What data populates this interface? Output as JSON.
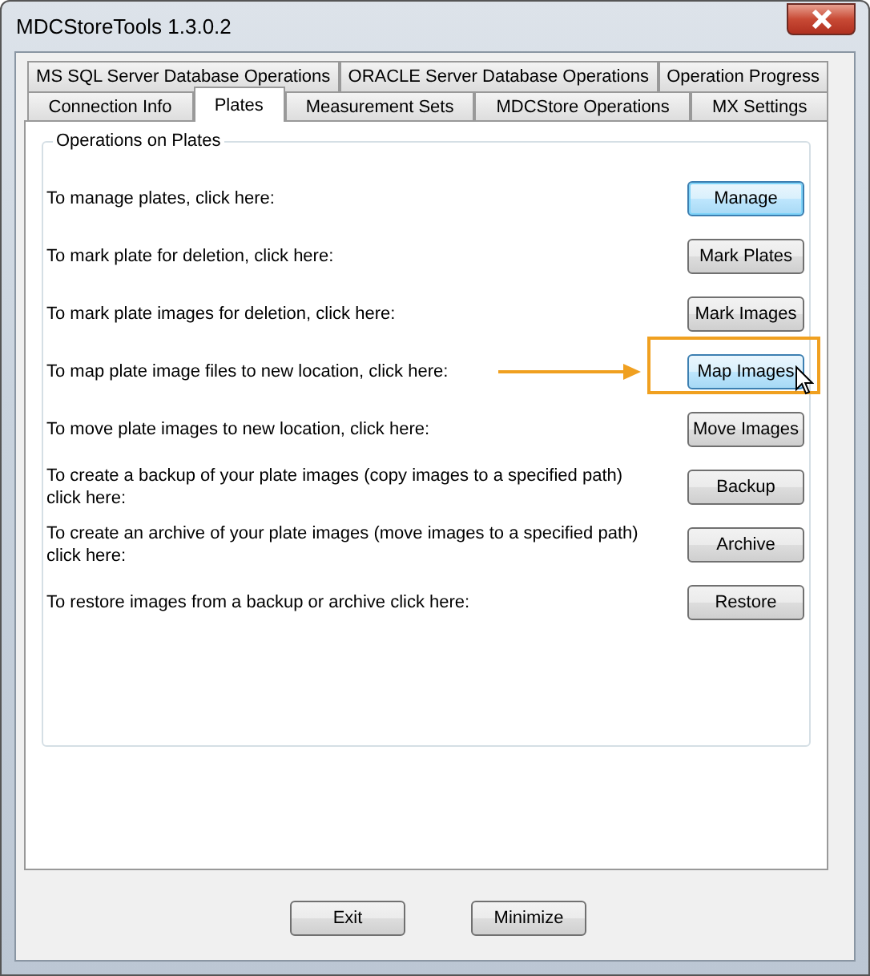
{
  "window": {
    "title": "MDCStoreTools 1.3.0.2"
  },
  "tab_rows": [
    [
      {
        "label": "MS SQL Server Database Operations",
        "selected": false
      },
      {
        "label": "ORACLE Server Database Operations",
        "selected": false
      },
      {
        "label": "Operation Progress",
        "selected": false
      }
    ],
    [
      {
        "label": "Connection Info",
        "selected": false
      },
      {
        "label": "Plates",
        "selected": true
      },
      {
        "label": "Measurement Sets",
        "selected": false
      },
      {
        "label": "MDCStore Operations",
        "selected": false
      },
      {
        "label": "MX Settings",
        "selected": false
      }
    ]
  ],
  "group": {
    "title": "Operations on Plates"
  },
  "operations": [
    {
      "text": "To manage plates, click here:",
      "button": "Manage",
      "focused": true,
      "hovered": false,
      "highlighted": false
    },
    {
      "text": "To mark plate for deletion, click here:",
      "button": "Mark Plates",
      "focused": false,
      "hovered": false,
      "highlighted": false
    },
    {
      "text": "To mark plate images for deletion, click here:",
      "button": "Mark Images",
      "focused": false,
      "hovered": false,
      "highlighted": false
    },
    {
      "text": "To map plate image files to new location, click here:",
      "button": "Map Images",
      "focused": false,
      "hovered": true,
      "highlighted": true
    },
    {
      "text": "To move plate images to new location, click here:",
      "button": "Move Images",
      "focused": false,
      "hovered": false,
      "highlighted": false
    },
    {
      "text": "To create a backup of your plate images (copy images to a specified path) click here:",
      "button": "Backup",
      "focused": false,
      "hovered": false,
      "highlighted": false
    },
    {
      "text": "To create an archive of your plate images (move images to a specified path) click here:",
      "button": "Archive",
      "focused": false,
      "hovered": false,
      "highlighted": false
    },
    {
      "text": "To restore images from a backup or archive click here:",
      "button": "Restore",
      "focused": false,
      "hovered": false,
      "highlighted": false
    }
  ],
  "footer_buttons": [
    "Exit",
    "Minimize"
  ]
}
